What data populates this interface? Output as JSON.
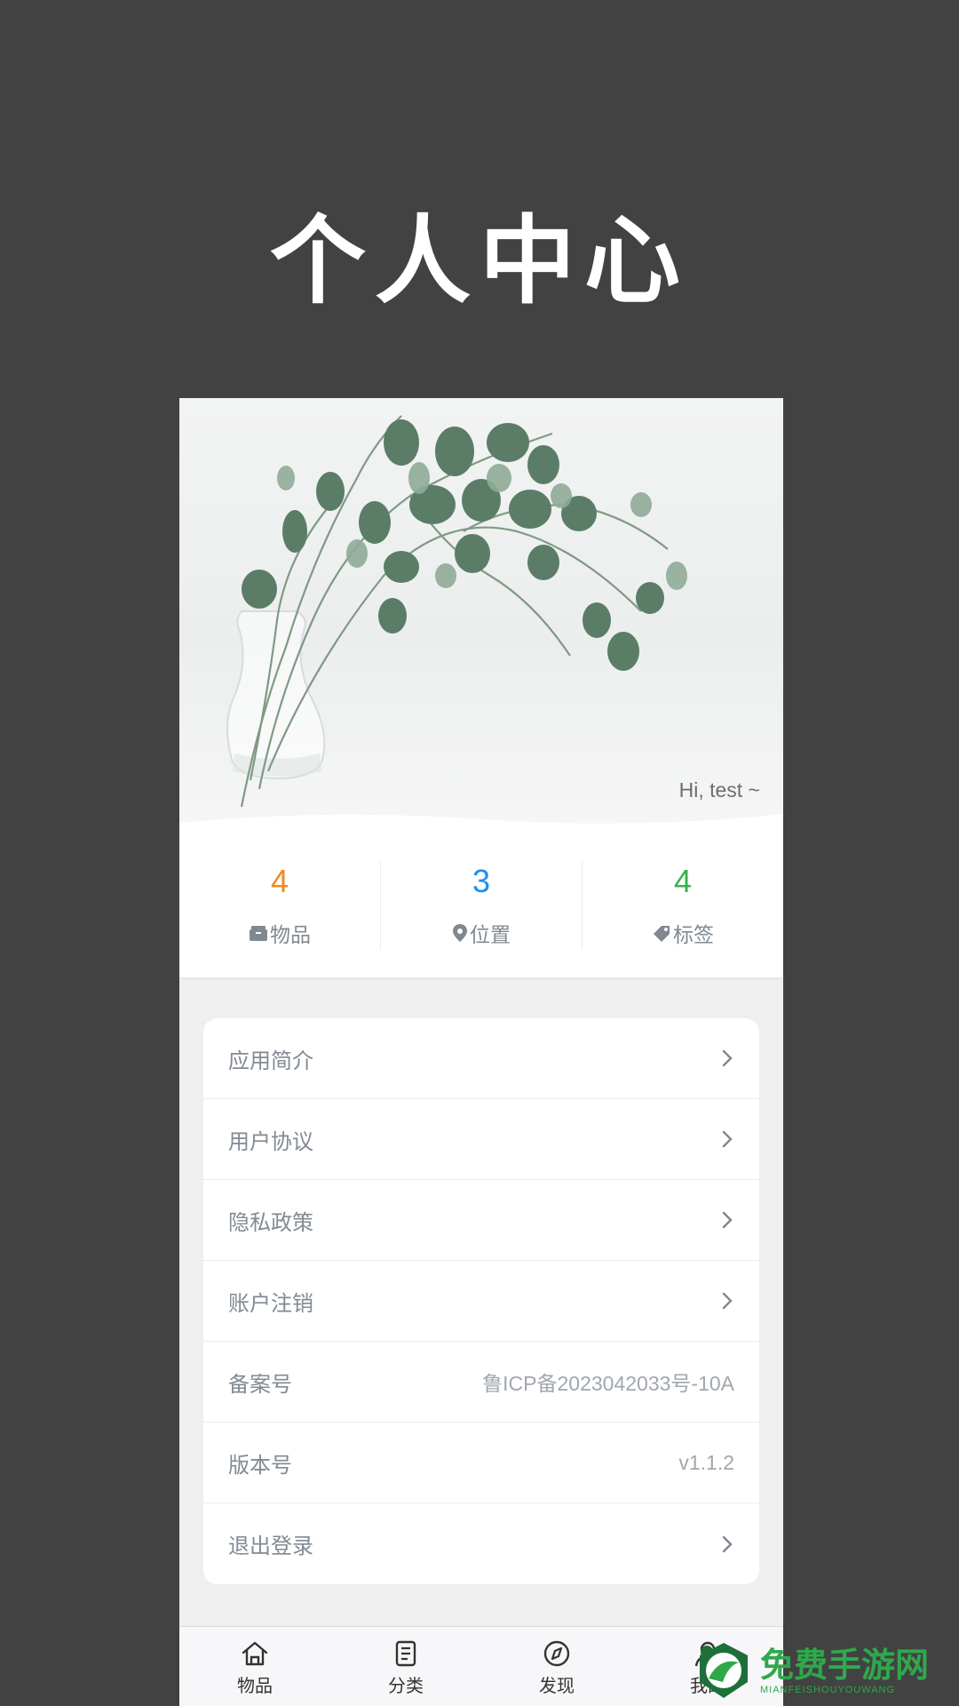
{
  "page_heading": "个人中心",
  "hero": {
    "greeting": "Hi, test ~"
  },
  "stats": [
    {
      "value": "4",
      "label": "物品",
      "color": "#f08a24",
      "icon": "box-icon"
    },
    {
      "value": "3",
      "label": "位置",
      "color": "#1d8ef0",
      "icon": "location-pin-icon"
    },
    {
      "value": "4",
      "label": "标签",
      "color": "#38b34a",
      "icon": "tag-icon"
    }
  ],
  "menu": [
    {
      "label": "应用简介",
      "value": "",
      "chevron": true
    },
    {
      "label": "用户协议",
      "value": "",
      "chevron": true
    },
    {
      "label": "隐私政策",
      "value": "",
      "chevron": true
    },
    {
      "label": "账户注销",
      "value": "",
      "chevron": true
    },
    {
      "label": "备案号",
      "value": "鲁ICP备2023042033号-10A",
      "chevron": false
    },
    {
      "label": "版本号",
      "value": "v1.1.2",
      "chevron": false
    },
    {
      "label": "退出登录",
      "value": "",
      "chevron": true
    }
  ],
  "tabbar": [
    {
      "label": "物品",
      "icon": "home-icon"
    },
    {
      "label": "分类",
      "icon": "document-icon"
    },
    {
      "label": "发现",
      "icon": "compass-icon"
    },
    {
      "label": "我的",
      "icon": "user-icon"
    }
  ],
  "watermark": {
    "main": "免费手游网",
    "sub": "MIANFEISHOUYOUWANG"
  }
}
